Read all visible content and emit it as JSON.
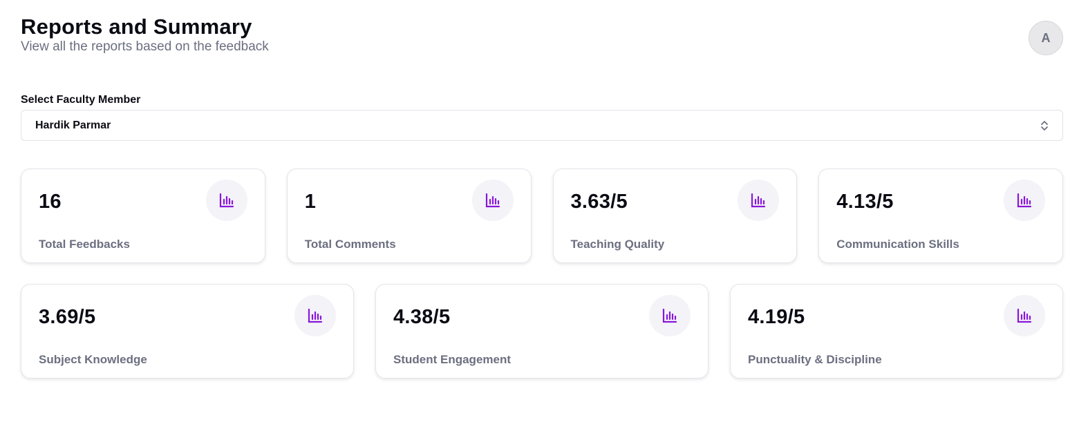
{
  "header": {
    "title": "Reports and Summary",
    "subtitle": "View all the reports based on the feedback"
  },
  "user": {
    "avatar_initial": "A"
  },
  "faculty_select": {
    "label": "Select Faculty Member",
    "selected": "Hardik Parmar",
    "icon": "chevron-up-down-icon"
  },
  "accent_color": "#8a16d9",
  "stats": [
    {
      "value": "16",
      "label": "Total Feedbacks",
      "icon": "bar-chart-icon"
    },
    {
      "value": "1",
      "label": "Total Comments",
      "icon": "bar-chart-icon"
    },
    {
      "value": "3.63/5",
      "label": "Teaching Quality",
      "icon": "bar-chart-icon"
    },
    {
      "value": "4.13/5",
      "label": "Communication Skills",
      "icon": "bar-chart-icon"
    },
    {
      "value": "3.69/5",
      "label": "Subject Knowledge",
      "icon": "bar-chart-icon"
    },
    {
      "value": "4.38/5",
      "label": "Student Engagement",
      "icon": "bar-chart-icon"
    },
    {
      "value": "4.19/5",
      "label": "Punctuality & Discipline",
      "icon": "bar-chart-icon"
    }
  ]
}
